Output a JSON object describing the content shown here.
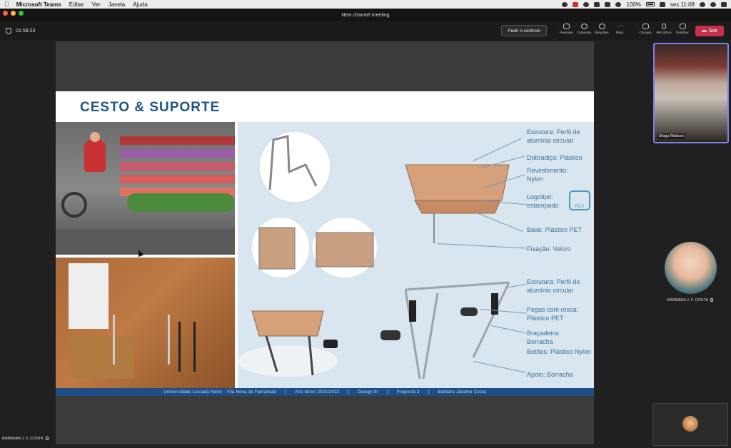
{
  "menubar": {
    "app": "Microsoft Teams",
    "items": [
      "Editar",
      "Ver",
      "Janela",
      "Ajuda"
    ],
    "battery": "100%",
    "clock": "sex 11:08"
  },
  "window": {
    "title": "New channel meeting"
  },
  "toolbar": {
    "timer": "01:59:23",
    "request_control": "Pedir o controlo",
    "buttons": [
      "Pessoas",
      "Conversa",
      "Reações",
      "Mais",
      "Câmara",
      "Microfone",
      "Partilhar"
    ],
    "leave": "Sair"
  },
  "slide": {
    "title": "CESTO & SUPORTE",
    "labels": [
      "Estrutura: Perfil de alumínio circular",
      "Dobradiça: Plástico",
      "Revestimento: Nylon",
      "Logotipo: estampado",
      "Base: Plástico PET",
      "Fixação: Velcro",
      "Estrutura: Perfil de alumínio circular",
      "Pegas com rosca: Plástico PET",
      "Braçadeira: Borracha",
      "Botões: Plástico Nylon",
      "Apoio: Borracha"
    ],
    "logo_text": "RCX",
    "footer": [
      "Universidade Lusíada Norte · Vila Nova de Famalicão",
      "|",
      "Ano letivo 2021/2022",
      "|",
      "Design III",
      "|",
      "Proposta 3",
      "|",
      "Bárbara Jácome Costa"
    ]
  },
  "participants": {
    "video": "Diogo Riobom",
    "avatar": "BÁRBARA J. F. COSTA",
    "bottom": "BÁRBARA J. F. COSTA"
  },
  "colors": {
    "title": "#1e5588",
    "label": "#3d6f9a",
    "footer": "#1f4e86",
    "leave": "#c4314b"
  }
}
